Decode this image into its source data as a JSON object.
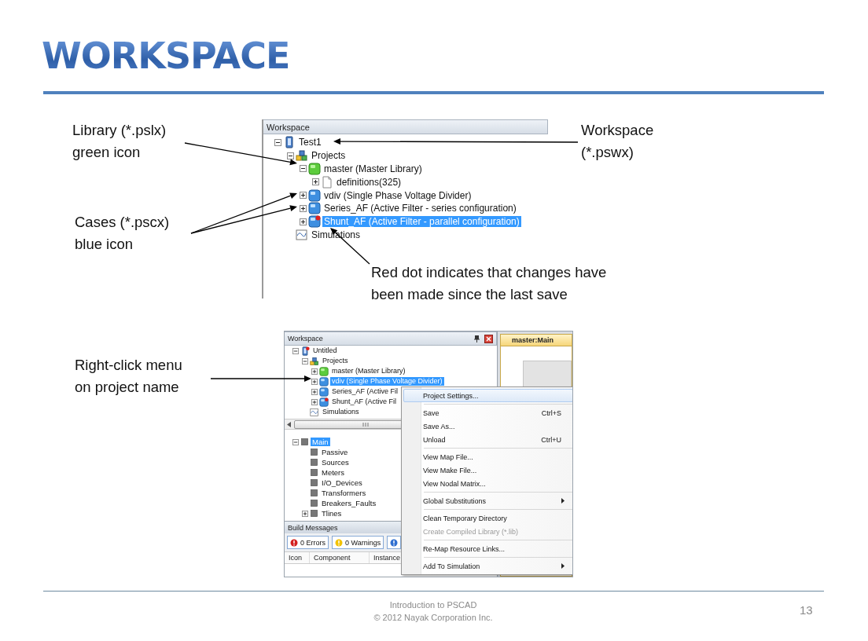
{
  "title": "WORKSPACE",
  "callouts": [
    {
      "text": "Library (*.pslx)\ngreen icon"
    },
    {
      "text": "Workspace\n(*.pswx)"
    },
    {
      "text": "Cases (*.pscx)\nblue icon"
    },
    {
      "text": "Red dot indicates that changes have\nbeen made since the last save"
    },
    {
      "text": "Right-click menu\non project name"
    }
  ],
  "workspace_view": {
    "panel_title": "Workspace",
    "tree": [
      {
        "label": "Test1",
        "kind": "workspace",
        "expanded": true,
        "selected": false,
        "modified": false,
        "children": [
          {
            "label": "Projects",
            "kind": "projects",
            "expanded": true,
            "selected": false,
            "modified": false,
            "children": [
              {
                "label": "master (Master Library)",
                "kind": "library",
                "expanded": true,
                "selected": false,
                "modified": false,
                "children": [
                  {
                    "label": "definitions(325)",
                    "kind": "definitions",
                    "expanded": false,
                    "selected": false,
                    "modified": false
                  }
                ]
              },
              {
                "label": "vdiv (Single Phase Voltage Divider)",
                "kind": "case",
                "expanded": false,
                "selected": false,
                "modified": false
              },
              {
                "label": "Series_AF (Active Filter - series configuration)",
                "kind": "case",
                "expanded": false,
                "selected": false,
                "modified": false
              },
              {
                "label": "Shunt_AF (Active Filter - parallel configuration)",
                "kind": "case",
                "expanded": false,
                "selected": true,
                "modified": true
              }
            ]
          },
          {
            "label": "Simulations",
            "kind": "simulations",
            "selected": false,
            "modified": false
          }
        ]
      }
    ]
  },
  "menu_view": {
    "panel_title": "Workspace",
    "tree": [
      {
        "label": "Untitled",
        "kind": "workspace",
        "expanded": true,
        "selected": false,
        "modified": true,
        "children": [
          {
            "label": "Projects",
            "kind": "projects",
            "expanded": true,
            "selected": false,
            "modified": false,
            "children": [
              {
                "label": "master (Master Library)",
                "kind": "library",
                "expanded": false,
                "selected": false,
                "modified": false
              },
              {
                "label": "vdiv (Single Phase Voltage Divider)",
                "kind": "case",
                "expanded": false,
                "selected": true,
                "modified": false
              },
              {
                "label": "Series_AF (Active Fil",
                "kind": "case",
                "expanded": false,
                "selected": false,
                "modified": false
              },
              {
                "label": "Shunt_AF (Active Fil",
                "kind": "case",
                "expanded": false,
                "selected": false,
                "modified": true
              }
            ]
          },
          {
            "label": "Simulations",
            "kind": "simulations",
            "selected": false,
            "modified": false
          }
        ]
      }
    ],
    "component_tree": [
      {
        "label": "Main",
        "kind": "module",
        "expanded": true,
        "selected": true,
        "modified": false,
        "children": [
          {
            "label": "Passive",
            "kind": "module",
            "selected": false,
            "modified": false
          },
          {
            "label": "Sources",
            "kind": "module",
            "selected": false,
            "modified": false
          },
          {
            "label": "Meters",
            "kind": "module",
            "selected": false,
            "modified": false
          },
          {
            "label": "I/O_Devices",
            "kind": "module",
            "selected": false,
            "modified": false
          },
          {
            "label": "Transformers",
            "kind": "module",
            "selected": false,
            "modified": false
          },
          {
            "label": "Breakers_Faults",
            "kind": "module",
            "selected": false,
            "modified": false
          },
          {
            "label": "Tlines",
            "kind": "module",
            "expanded": false,
            "selected": false,
            "modified": false
          }
        ]
      }
    ],
    "build_messages": {
      "title": "Build Messages",
      "filters": [
        {
          "kind": "error",
          "label": "0 Errors"
        },
        {
          "kind": "warning",
          "label": "0 Warnings"
        },
        {
          "kind": "info"
        }
      ],
      "columns": [
        "Icon",
        "Component",
        "Instance"
      ]
    },
    "tab": "master:Main",
    "context_menu": [
      {
        "kind": "item",
        "label": "Project Settings...",
        "selected": true,
        "disabled": false,
        "submenu": false
      },
      {
        "kind": "separator"
      },
      {
        "kind": "item",
        "label": "Save",
        "shortcut": "Ctrl+S",
        "selected": false,
        "disabled": false,
        "submenu": false
      },
      {
        "kind": "item",
        "label": "Save As...",
        "selected": false,
        "disabled": false,
        "submenu": false
      },
      {
        "kind": "item",
        "label": "Unload",
        "shortcut": "Ctrl+U",
        "selected": false,
        "disabled": false,
        "submenu": false
      },
      {
        "kind": "separator"
      },
      {
        "kind": "item",
        "label": "View Map File...",
        "selected": false,
        "disabled": false,
        "submenu": false
      },
      {
        "kind": "item",
        "label": "View Make File...",
        "selected": false,
        "disabled": false,
        "submenu": false
      },
      {
        "kind": "item",
        "label": "View Nodal Matrix...",
        "selected": false,
        "disabled": false,
        "submenu": false
      },
      {
        "kind": "separator"
      },
      {
        "kind": "item",
        "label": "Global Substitutions",
        "selected": false,
        "disabled": false,
        "submenu": true
      },
      {
        "kind": "separator"
      },
      {
        "kind": "item",
        "label": "Clean Temporary Directory",
        "selected": false,
        "disabled": false,
        "submenu": false
      },
      {
        "kind": "item",
        "label": "Create Compiled Library (*.lib)",
        "selected": false,
        "disabled": true,
        "submenu": false
      },
      {
        "kind": "separator"
      },
      {
        "kind": "item",
        "label": "Re-Map Resource Links...",
        "selected": false,
        "disabled": false,
        "submenu": false
      },
      {
        "kind": "separator"
      },
      {
        "kind": "item",
        "label": "Add To Simulation",
        "selected": false,
        "disabled": false,
        "submenu": true
      }
    ]
  },
  "footer": {
    "lines": [
      "Introduction to PSCAD",
      "© 2012 Nayak Corporation Inc."
    ],
    "page_number": "13"
  }
}
